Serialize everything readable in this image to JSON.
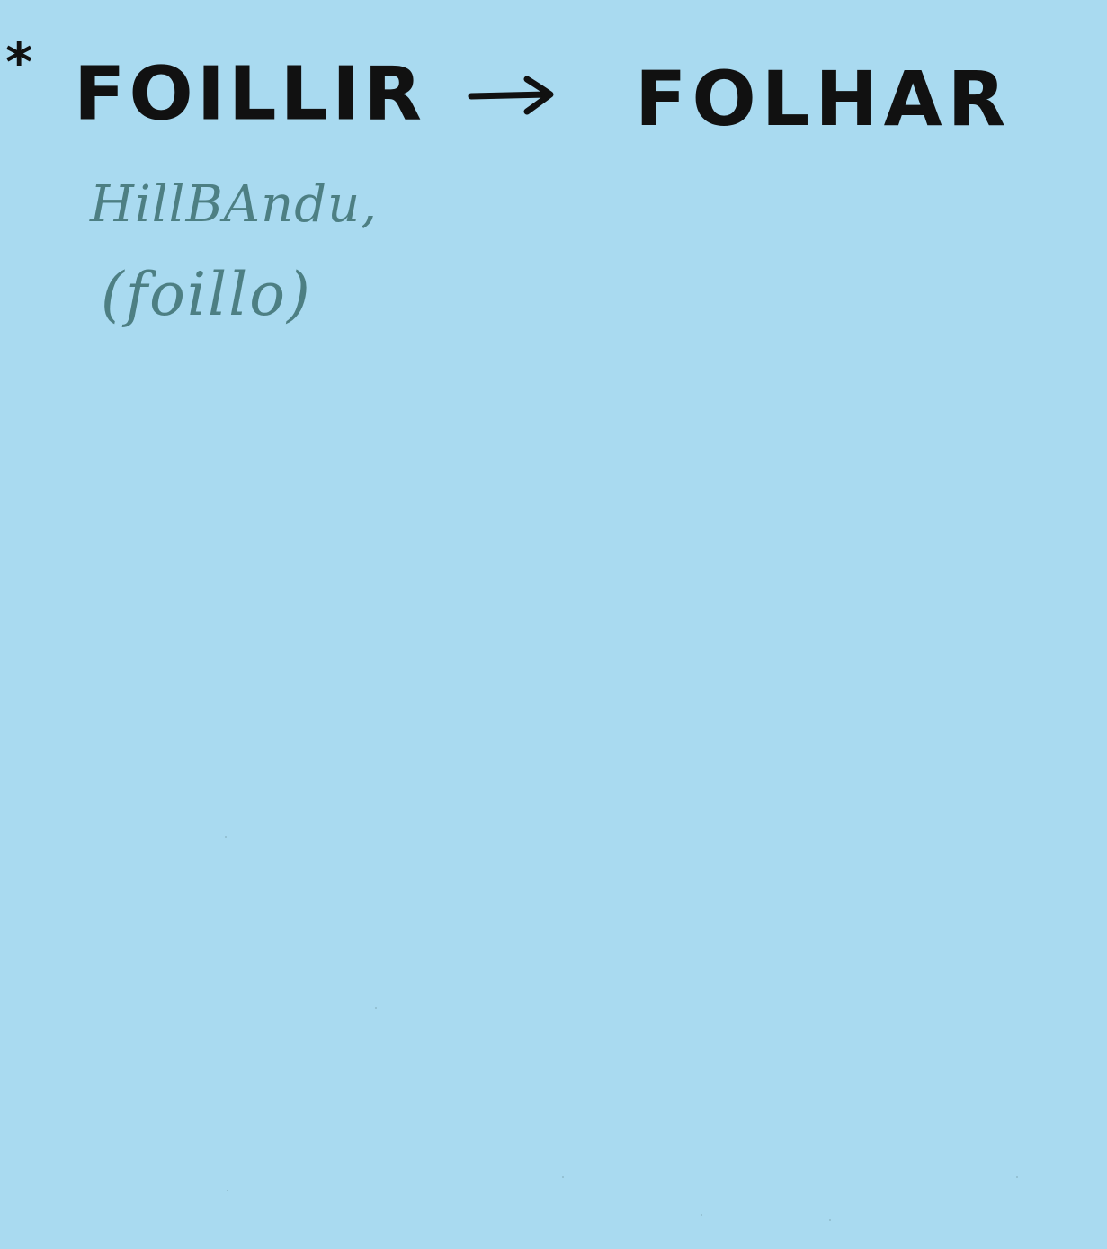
{
  "card": {
    "background_color": "#a9daf0",
    "ink_color": "#111111",
    "pencil_color": "#4d7f83"
  },
  "entry": {
    "marker": "*",
    "headword": "FOILLIR",
    "arrow_icon": "right-arrow-icon",
    "target_word": "FOLHAR"
  },
  "notes": {
    "source": "HillBAndu,",
    "form": "(foillo)"
  }
}
